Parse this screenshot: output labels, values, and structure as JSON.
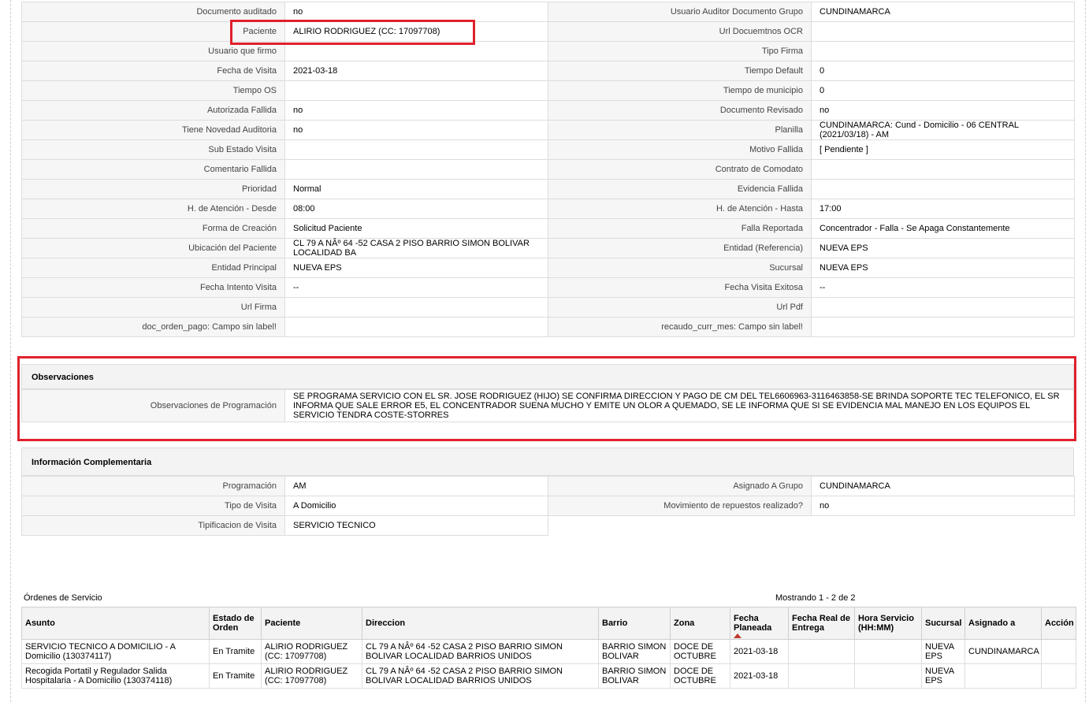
{
  "detail_rows": [
    {
      "l1": "Documento auditado",
      "v1": "no",
      "l2": "Usuario Auditor Documento Grupo",
      "v2": "CUNDINAMARCA"
    },
    {
      "l1": "Paciente",
      "v1": "ALIRIO RODRIGUEZ (CC: 17097708)",
      "l2": "Url Docuemtnos OCR",
      "v2": ""
    },
    {
      "l1": "Usuario que firmo",
      "v1": "",
      "l2": "Tipo Firma",
      "v2": ""
    },
    {
      "l1": "Fecha de Visita",
      "v1": "2021-03-18",
      "l2": "Tiempo Default",
      "v2": "0"
    },
    {
      "l1": "Tiempo OS",
      "v1": "",
      "l2": "Tiempo de municipio",
      "v2": "0"
    },
    {
      "l1": "Autorizada Fallida",
      "v1": "no",
      "l2": "Documento Revisado",
      "v2": "no"
    },
    {
      "l1": "Tiene Novedad Auditoria",
      "v1": "no",
      "l2": "Planilla",
      "v2": "CUNDINAMARCA: Cund - Domicilio - 06 CENTRAL (2021/03/18) - AM"
    },
    {
      "l1": "Sub Estado Visita",
      "v1": "",
      "l2": "Motivo Fallida",
      "v2": "[ Pendiente ]"
    },
    {
      "l1": "Comentario Fallida",
      "v1": "",
      "l2": "Contrato de Comodato",
      "v2": ""
    },
    {
      "l1": "Prioridad",
      "v1": "Normal",
      "l2": "Evidencia Fallida",
      "v2": ""
    },
    {
      "l1": "H. de Atención - Desde",
      "v1": "08:00",
      "l2": "H. de Atención - Hasta",
      "v2": "17:00"
    },
    {
      "l1": "Forma de Creación",
      "v1": "Solicitud Paciente",
      "l2": "Falla Reportada",
      "v2": "Concentrador - Falla - Se Apaga Constantemente"
    },
    {
      "l1": "Ubicación del Paciente",
      "v1": "CL 79 A NÂº 64 -52 CASA 2 PISO BARRIO SIMON BOLIVAR LOCALIDAD BA",
      "l2": "Entidad (Referencia)",
      "v2": "NUEVA EPS"
    },
    {
      "l1": "Entidad Principal",
      "v1": "NUEVA EPS",
      "l2": "Sucursal",
      "v2": "NUEVA EPS"
    },
    {
      "l1": "Fecha Intento Visita",
      "v1": "--",
      "l2": "Fecha Visita Exitosa",
      "v2": "--"
    },
    {
      "l1": "Url Firma",
      "v1": "",
      "l2": "Url Pdf",
      "v2": ""
    },
    {
      "l1": "doc_orden_pago: Campo sin label!",
      "v1": "",
      "l2": "recaudo_curr_mes: Campo sin label!",
      "v2": ""
    }
  ],
  "observaciones": {
    "title": "Observaciones",
    "label": "Observaciones de Programación",
    "text": "SE PROGRAMA SERVICIO CON EL SR. JOSE RODRIGUEZ (HIJO) SE CONFIRMA DIRECCION Y PAGO DE CM DEL TEL6606963-3116463858-SE BRINDA SOPORTE TEC TELEFONICO, EL SR INFORMA QUE SALE ERROR E5, EL CONCENTRADOR SUENA MUCHO Y EMITE UN OLOR A QUEMADO, SE LE INFORMA QUE SI SE EVIDENCIA MAL MANEJO EN LOS EQUIPOS EL SERVICIO TENDRA COSTE-STORRES"
  },
  "complementaria": {
    "title": "Información Complementaria",
    "rows": [
      {
        "l1": "Programación",
        "v1": "AM",
        "l2": "Asignado A Grupo",
        "v2": "CUNDINAMARCA"
      },
      {
        "l1": "Tipo de Visita",
        "v1": "A Domicilio",
        "l2": "Movimiento de repuestos realizado?",
        "v2": "no"
      },
      {
        "l1": "Tipificacion de Visita",
        "v1": "SERVICIO TECNICO",
        "l2": "",
        "v2": ""
      }
    ]
  },
  "orders": {
    "title": "Órdenes de Servicio",
    "count": "Mostrando 1 - 2 de 2",
    "headers": {
      "asunto": "Asunto",
      "estado": "Estado de Orden",
      "paciente": "Paciente",
      "direccion": "Direccion",
      "barrio": "Barrio",
      "zona": "Zona",
      "fecha_planeada": "Fecha Planeada",
      "fecha_real": "Fecha Real de Entrega",
      "hora": "Hora Servicio (HH:MM)",
      "sucursal": "Sucursal",
      "asignado": "Asignado a",
      "accion": "Acción"
    },
    "rows": [
      {
        "asunto": "SERVICIO TECNICO A DOMICILIO - A Domicilio (130374117)",
        "estado": "En Tramite",
        "paciente": "ALIRIO RODRIGUEZ (CC: 17097708)",
        "direccion": "CL 79 A NÂº 64 -52 CASA 2 PISO BARRIO SIMON BOLIVAR LOCALIDAD BARRIOS UNIDOS",
        "barrio": "BARRIO SIMON BOLIVAR",
        "zona": "DOCE DE OCTUBRE",
        "fecha_planeada": "2021-03-18",
        "fecha_real": "",
        "hora": "",
        "sucursal": "NUEVA EPS",
        "asignado": "CUNDINAMARCA",
        "accion": ""
      },
      {
        "asunto": "Recogida Portatil y Regulador Salida Hospitalaria - A Domicilio (130374118)",
        "estado": "En Tramite",
        "paciente": "ALIRIO RODRIGUEZ (CC: 17097708)",
        "direccion": "CL 79 A NÂº 64 -52 CASA 2 PISO BARRIO SIMON BOLIVAR LOCALIDAD BARRIOS UNIDOS",
        "barrio": "BARRIO SIMON BOLIVAR",
        "zona": "DOCE DE OCTUBRE",
        "fecha_planeada": "2021-03-18",
        "fecha_real": "",
        "hora": "",
        "sucursal": "NUEVA EPS",
        "asignado": "",
        "accion": ""
      }
    ]
  },
  "colors": {
    "highlight": "#e0212c",
    "label_bg": "#f6f6f6",
    "header_bg": "#f3f3f3",
    "sort_arrow": "#c0392b"
  }
}
